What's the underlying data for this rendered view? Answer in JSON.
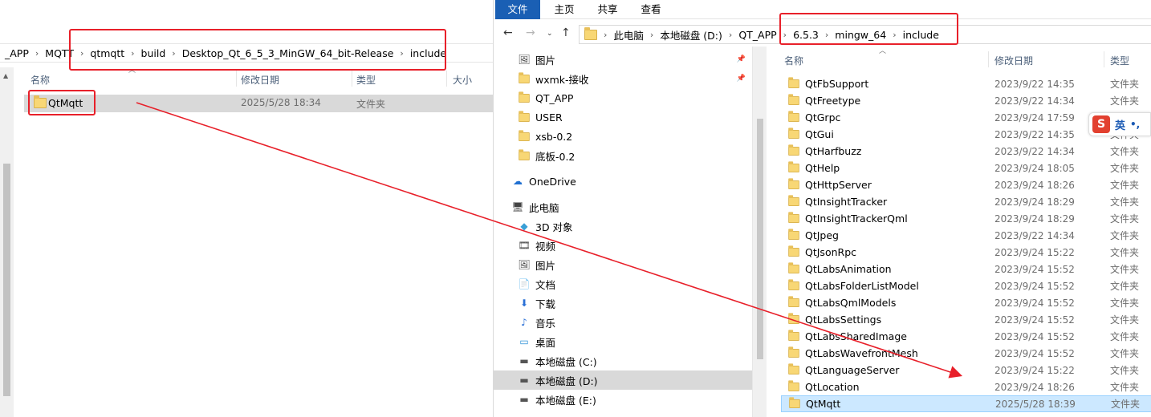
{
  "left": {
    "breadcrumbs": [
      "_APP",
      "MQTT",
      "qtmqtt",
      "build",
      "Desktop_Qt_6_5_3_MinGW_64_bit-Release",
      "include"
    ],
    "columns": {
      "name": "名称",
      "date": "修改日期",
      "type": "类型",
      "size": "大小"
    },
    "row": {
      "name": "QtMqtt",
      "date": "2025/5/28 18:34",
      "type": "文件夹"
    }
  },
  "right": {
    "ribbon": {
      "file": "文件",
      "home": "主页",
      "share": "共享",
      "view": "查看"
    },
    "path": [
      "此电脑",
      "本地磁盘 (D:)",
      "QT_APP",
      "6.5.3",
      "mingw_64",
      "include"
    ],
    "nav_items": [
      {
        "label": "图片",
        "icon": "pictures-icon",
        "pinned": true
      },
      {
        "label": "wxmk-接收",
        "icon": "folder-icon",
        "pinned": true
      },
      {
        "label": "QT_APP",
        "icon": "folder-icon",
        "pinned": false
      },
      {
        "label": "USER",
        "icon": "folder-icon",
        "pinned": false
      },
      {
        "label": "xsb-0.2",
        "icon": "folder-icon",
        "pinned": false
      },
      {
        "label": "底板-0.2",
        "icon": "folder-icon",
        "pinned": false
      },
      {
        "label": "OneDrive",
        "icon": "onedrive-icon",
        "pinned": false
      },
      {
        "label": "此电脑",
        "icon": "computer-icon",
        "pinned": false
      },
      {
        "label": "3D 对象",
        "icon": "3d-objects-icon",
        "pinned": false
      },
      {
        "label": "视频",
        "icon": "video-icon",
        "pinned": false
      },
      {
        "label": "图片",
        "icon": "pictures-icon",
        "pinned": false
      },
      {
        "label": "文档",
        "icon": "documents-icon",
        "pinned": false
      },
      {
        "label": "下载",
        "icon": "download-icon",
        "pinned": false
      },
      {
        "label": "音乐",
        "icon": "music-icon",
        "pinned": false
      },
      {
        "label": "桌面",
        "icon": "desktop-icon",
        "pinned": false
      },
      {
        "label": "本地磁盘 (C:)",
        "icon": "drive-icon",
        "pinned": false
      },
      {
        "label": "本地磁盘 (D:)",
        "icon": "drive-icon",
        "pinned": false,
        "selected": true
      },
      {
        "label": "本地磁盘 (E:)",
        "icon": "drive-icon",
        "pinned": false
      }
    ],
    "columns": {
      "name": "名称",
      "date": "修改日期",
      "type": "类型"
    },
    "rows": [
      {
        "name": "QtFbSupport",
        "date": "2023/9/22 14:35",
        "type": "文件夹"
      },
      {
        "name": "QtFreetype",
        "date": "2023/9/22 14:34",
        "type": "文件夹"
      },
      {
        "name": "QtGrpc",
        "date": "2023/9/24 17:59",
        "type": "文件夹"
      },
      {
        "name": "QtGui",
        "date": "2023/9/22 14:35",
        "type": "文件夹"
      },
      {
        "name": "QtHarfbuzz",
        "date": "2023/9/22 14:34",
        "type": "文件夹"
      },
      {
        "name": "QtHelp",
        "date": "2023/9/24 18:05",
        "type": "文件夹"
      },
      {
        "name": "QtHttpServer",
        "date": "2023/9/24 18:26",
        "type": "文件夹"
      },
      {
        "name": "QtInsightTracker",
        "date": "2023/9/24 18:29",
        "type": "文件夹"
      },
      {
        "name": "QtInsightTrackerQml",
        "date": "2023/9/24 18:29",
        "type": "文件夹"
      },
      {
        "name": "QtJpeg",
        "date": "2023/9/22 14:34",
        "type": "文件夹"
      },
      {
        "name": "QtJsonRpc",
        "date": "2023/9/24 15:22",
        "type": "文件夹"
      },
      {
        "name": "QtLabsAnimation",
        "date": "2023/9/24 15:52",
        "type": "文件夹"
      },
      {
        "name": "QtLabsFolderListModel",
        "date": "2023/9/24 15:52",
        "type": "文件夹"
      },
      {
        "name": "QtLabsQmlModels",
        "date": "2023/9/24 15:52",
        "type": "文件夹"
      },
      {
        "name": "QtLabsSettings",
        "date": "2023/9/24 15:52",
        "type": "文件夹"
      },
      {
        "name": "QtLabsSharedImage",
        "date": "2023/9/24 15:52",
        "type": "文件夹"
      },
      {
        "name": "QtLabsWavefrontMesh",
        "date": "2023/9/24 15:52",
        "type": "文件夹"
      },
      {
        "name": "QtLanguageServer",
        "date": "2023/9/24 15:22",
        "type": "文件夹"
      },
      {
        "name": "QtLocation",
        "date": "2023/9/24 18:26",
        "type": "文件夹"
      },
      {
        "name": "QtMqtt",
        "date": "2025/5/28 18:39",
        "type": "文件夹",
        "selected": true
      }
    ]
  },
  "ime": {
    "logo": "S",
    "lang": "英",
    "punct": "•,"
  },
  "colors": {
    "annotation_red": "#e8202a",
    "ribbon_blue": "#1a5fb4",
    "folder_yellow": "#f8d775",
    "selection_blue": "#cce8ff"
  }
}
